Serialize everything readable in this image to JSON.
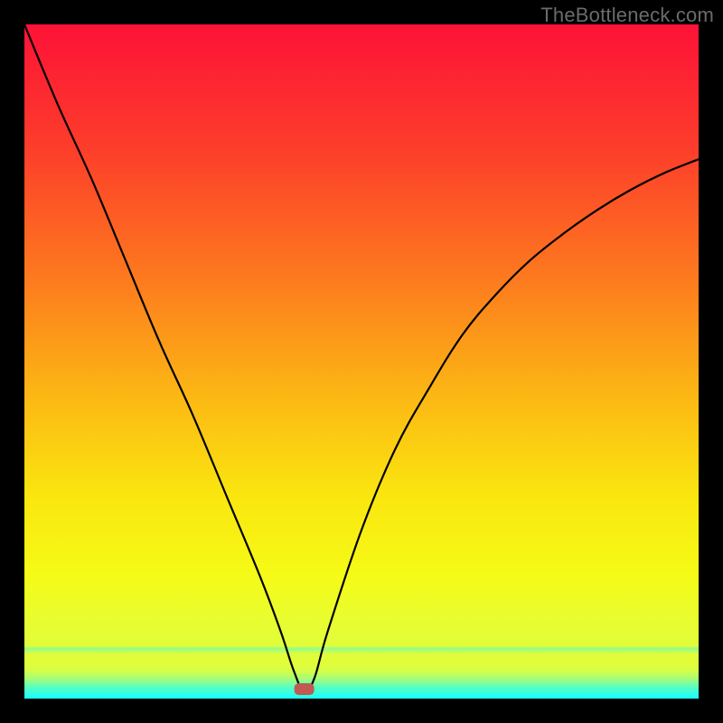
{
  "watermark": "TheBottleneck.com",
  "chart_data": {
    "type": "line",
    "title": "",
    "xlabel": "",
    "ylabel": "",
    "xlim": [
      0,
      100
    ],
    "ylim": [
      0,
      100
    ],
    "series": [
      {
        "name": "curve",
        "x": [
          0,
          5,
          10,
          15,
          20,
          25,
          30,
          35,
          38,
          40,
          41.5,
          43,
          45,
          50,
          55,
          60,
          65,
          70,
          75,
          80,
          85,
          90,
          95,
          100
        ],
        "values": [
          100,
          88,
          77,
          65,
          53,
          42,
          30,
          18,
          10,
          4,
          1.0,
          3,
          10,
          25,
          37,
          46,
          54,
          60,
          65,
          69,
          72.5,
          75.5,
          78,
          80
        ]
      }
    ],
    "marker": {
      "x": 41.5,
      "y": 1.4
    },
    "gradient_stops": [
      {
        "offset": 0,
        "color": "#fd1237"
      },
      {
        "offset": 18,
        "color": "#fd3c2b"
      },
      {
        "offset": 38,
        "color": "#fd7b1e"
      },
      {
        "offset": 55,
        "color": "#fcb714"
      },
      {
        "offset": 70,
        "color": "#fae60f"
      },
      {
        "offset": 82,
        "color": "#f5fb17"
      },
      {
        "offset": 88,
        "color": "#e9fd2f"
      },
      {
        "offset": 92.2,
        "color": "#e1fd3a"
      },
      {
        "offset": 92.6,
        "color": "#92fd8c"
      },
      {
        "offset": 93.4,
        "color": "#e1fd3a"
      },
      {
        "offset": 94.8,
        "color": "#e1fd3a"
      },
      {
        "offset": 95.8,
        "color": "#d7fe46"
      },
      {
        "offset": 97.0,
        "color": "#a9fd74"
      },
      {
        "offset": 98.3,
        "color": "#59fec1"
      },
      {
        "offset": 100,
        "color": "#16feff"
      }
    ]
  }
}
